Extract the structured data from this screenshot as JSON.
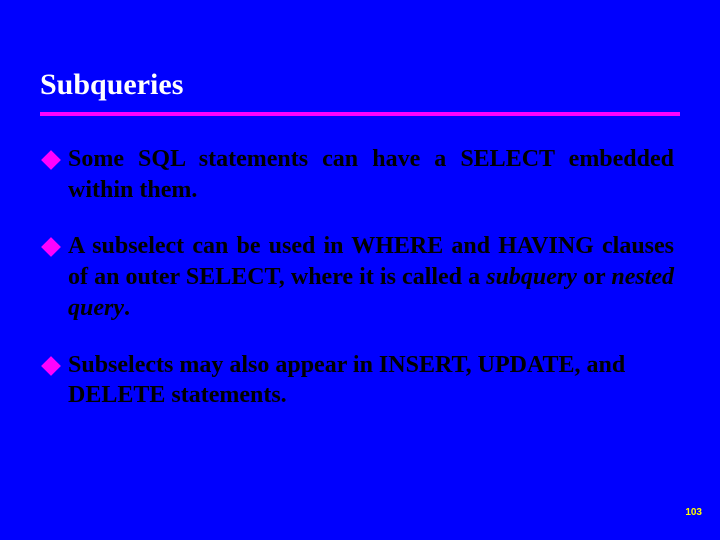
{
  "title": "Subqueries",
  "bullets": {
    "b1": "Some SQL statements can have a SELECT embedded within them.",
    "b2_pre": "A subselect can be used in WHERE and HAVING clauses of an outer SELECT, where it is called a ",
    "b2_em1": "subquery",
    "b2_mid": " or ",
    "b2_em2": "nested query",
    "b2_post": ".",
    "b3": "Subselects may also appear in INSERT, UPDATE, and DELETE statements."
  },
  "page_number": "103",
  "colors": {
    "background": "#0000fe",
    "accent": "#ff00ff",
    "text": "#000000",
    "title": "#ffffff",
    "pagenum": "#ffff00"
  }
}
